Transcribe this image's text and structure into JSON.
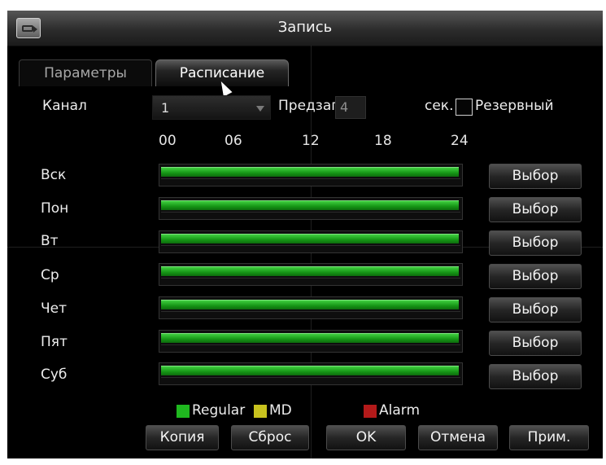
{
  "window": {
    "title": "Запись"
  },
  "tabs": [
    {
      "label": "Параметры",
      "active": false
    },
    {
      "label": "Расписание",
      "active": true
    }
  ],
  "settings": {
    "channel_label": "Канал",
    "channel_value": "1",
    "prerecord_label": "Предзапись",
    "prerecord_value": "4",
    "seconds_label": "сек.",
    "reserve_label": "Резервный",
    "reserve_checked": false
  },
  "hours": [
    "00",
    "06",
    "12",
    "18",
    "24"
  ],
  "days": [
    {
      "label": "Вск",
      "button": "Выбор",
      "regular": [
        0,
        24
      ]
    },
    {
      "label": "Пон",
      "button": "Выбор",
      "regular": [
        0,
        24
      ]
    },
    {
      "label": "Вт",
      "button": "Выбор",
      "regular": [
        0,
        24
      ]
    },
    {
      "label": "Ср",
      "button": "Выбор",
      "regular": [
        0,
        24
      ]
    },
    {
      "label": "Чет",
      "button": "Выбор",
      "regular": [
        0,
        24
      ]
    },
    {
      "label": "Пят",
      "button": "Выбор",
      "regular": [
        0,
        24
      ]
    },
    {
      "label": "Суб",
      "button": "Выбор",
      "regular": [
        0,
        24
      ]
    }
  ],
  "legend": [
    {
      "label": "Regular",
      "color": "#1fb81f"
    },
    {
      "label": "MD",
      "color": "#c8c21e"
    },
    {
      "label": "Alarm",
      "color": "#b31a1a"
    }
  ],
  "buttons": {
    "copy": "Копия",
    "reset": "Сброс",
    "ok": "OK",
    "cancel": "Отмена",
    "apply": "Прим."
  },
  "icons": {
    "app": "camera-icon",
    "cursor": "mouse-pointer-icon",
    "channel_dropdown": "chevron-down-icon"
  }
}
